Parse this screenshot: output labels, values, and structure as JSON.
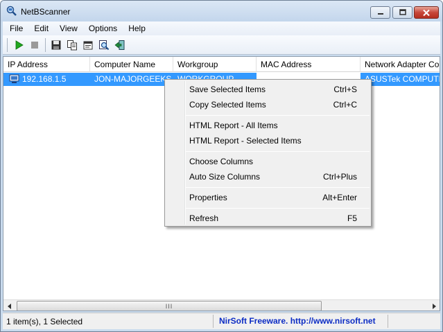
{
  "window": {
    "title": "NetBScanner"
  },
  "menu": [
    "File",
    "Edit",
    "View",
    "Options",
    "Help"
  ],
  "columns": [
    "IP Address",
    "Computer Name",
    "Workgroup",
    "MAC Address",
    "Network Adapter Co"
  ],
  "rows": [
    {
      "ip": "192.168.1.5",
      "computer": "JON-MAJORGEEKS",
      "workgroup": "WORKGROUP",
      "mac": "",
      "adapter": "ASUSTek COMPUTE"
    }
  ],
  "context_menu": {
    "items": [
      {
        "label": "Save Selected Items",
        "shortcut": "Ctrl+S"
      },
      {
        "label": "Copy Selected Items",
        "shortcut": "Ctrl+C"
      },
      {
        "label": "HTML Report - All Items",
        "shortcut": ""
      },
      {
        "label": "HTML Report - Selected Items",
        "shortcut": ""
      },
      {
        "label": "Choose Columns",
        "shortcut": ""
      },
      {
        "label": "Auto Size Columns",
        "shortcut": "Ctrl+Plus"
      },
      {
        "label": "Properties",
        "shortcut": "Alt+Enter"
      },
      {
        "label": "Refresh",
        "shortcut": "F5"
      }
    ]
  },
  "status": {
    "count": "1 item(s), 1 Selected",
    "link": "NirSoft Freeware.  http://www.nirsoft.net"
  },
  "scrollbar": {
    "thumb_grip": "III"
  },
  "colors": {
    "selection": "#3399ff",
    "link": "#0c2cc4",
    "play": "#1fa81f"
  }
}
